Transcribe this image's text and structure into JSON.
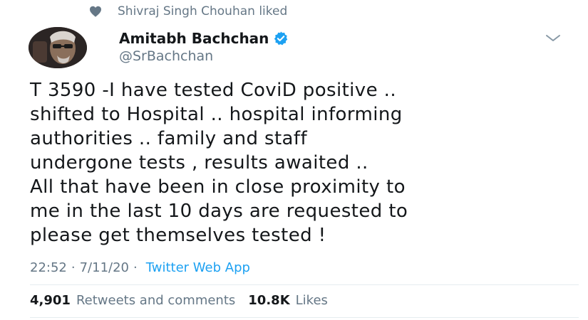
{
  "social_context": {
    "icon": "heart-icon",
    "text": "Shivraj Singh Chouhan liked"
  },
  "author": {
    "name": "Amitabh Bachchan",
    "handle": "@SrBachchan",
    "verified_icon": "verified-badge-icon",
    "verified_color": "#1da1f2"
  },
  "tweet": {
    "text": "T 3590 -I have tested CoviD positive ..\nshifted to Hospital  .. hospital informing\nauthorities .. family and staff\nundergone tests , results awaited ..\nAll that have been in close proximity to\nme in the last 10 days are requested to\nplease get themselves tested !"
  },
  "meta": {
    "time": "22:52",
    "date": "7/11/20",
    "separator": "·",
    "source": "Twitter Web App"
  },
  "stats": {
    "retweets_count": "4,901",
    "retweets_label": "Retweets and comments",
    "likes_count": "10.8K",
    "likes_label": "Likes"
  },
  "colors": {
    "text_primary": "#14171a",
    "text_secondary": "#657786",
    "link": "#1da1f2",
    "divider": "#e6ecf0"
  }
}
